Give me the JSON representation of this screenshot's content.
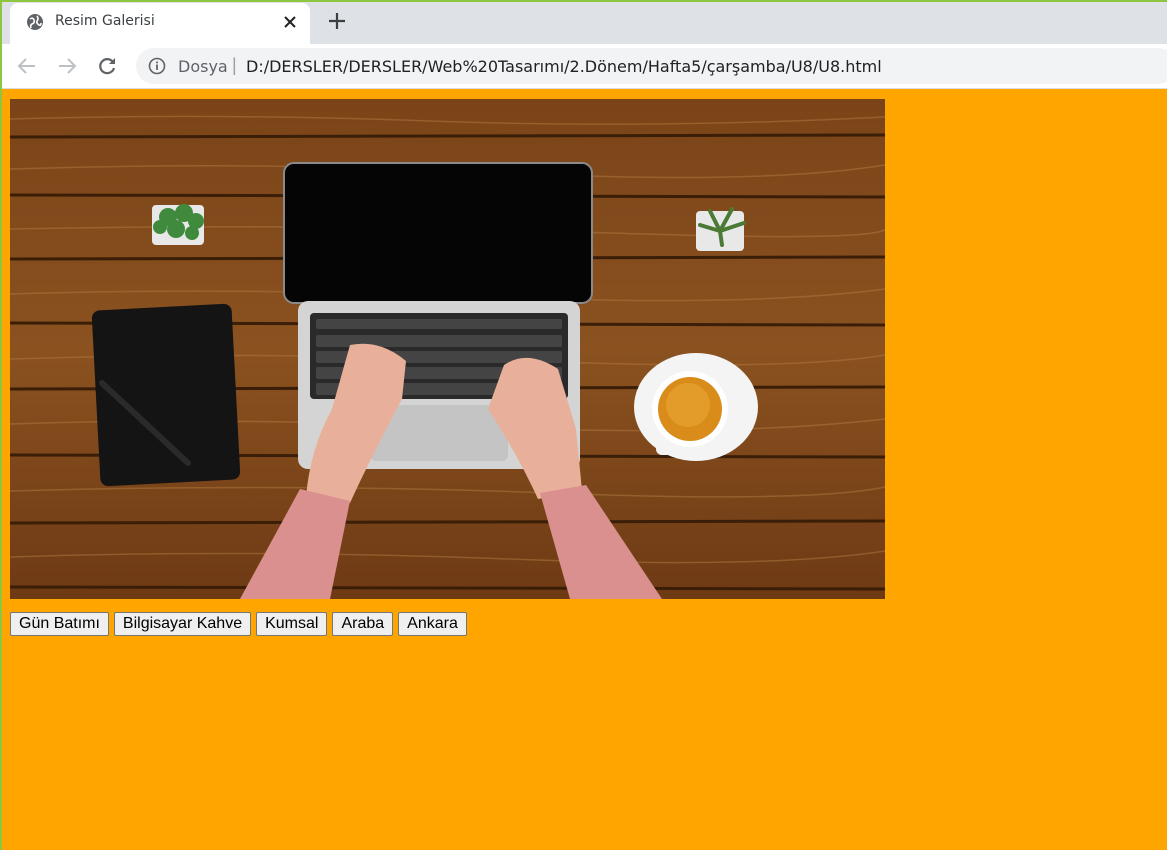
{
  "browser": {
    "tab": {
      "title": "Resim Galerisi",
      "icon": "globe-icon"
    },
    "address_bar": {
      "scheme_label": "Dosya",
      "separator": "|",
      "url": "D:/DERSLER/DERSLER/Web%20Tasarımı/2.Dönem/Hafta5/çarşamba/U8/U8.html"
    }
  },
  "page": {
    "background_color": "#ffa500",
    "image": {
      "description_icon": "laptop-coffee-desk-photo"
    },
    "buttons": [
      {
        "label": "Gün Batımı"
      },
      {
        "label": "Bilgisayar Kahve"
      },
      {
        "label": "Kumsal"
      },
      {
        "label": "Araba"
      },
      {
        "label": "Ankara"
      }
    ]
  }
}
